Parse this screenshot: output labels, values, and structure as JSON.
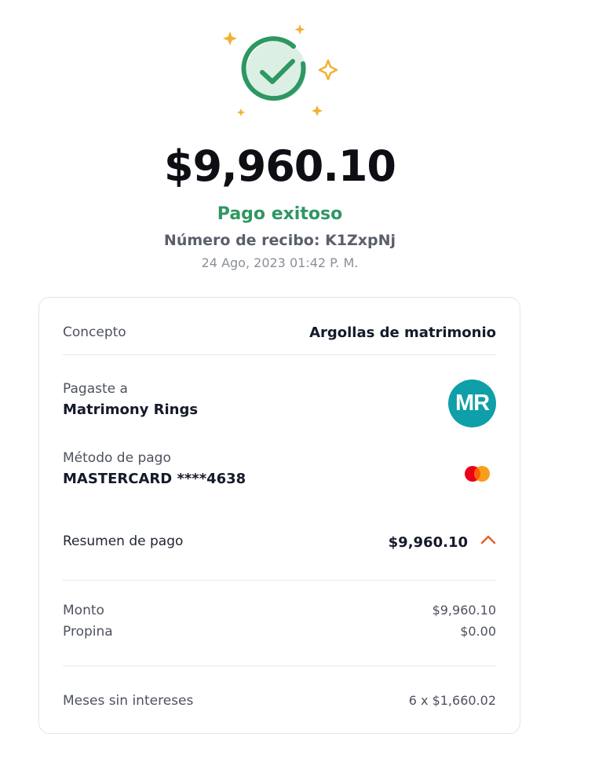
{
  "header": {
    "amount": "$9,960.10",
    "status": "Pago exitoso",
    "receipt": "Número de recibo: K1ZxpNj",
    "date": "24 Ago, 2023 01:42 P. M."
  },
  "colors": {
    "success": "#2e9762",
    "sparkle": "#f2b134",
    "avatar": "#0f9fa8",
    "accent": "#e5622a"
  },
  "details": {
    "concept_label": "Concepto",
    "concept_value": "Argollas de matrimonio",
    "paid_to_label": "Pagaste a",
    "paid_to_value": "Matrimony Rings",
    "avatar_initials": "MR",
    "method_label": "Método de pago",
    "method_value": "MASTERCARD ****4638",
    "method_icon": "mastercard-icon"
  },
  "summary": {
    "label": "Resumen de pago",
    "total": "$9,960.10",
    "expanded": true,
    "items": [
      {
        "label": "Monto",
        "value": "$9,960.10"
      },
      {
        "label": "Propina",
        "value": "$0.00"
      }
    ],
    "msi_label": "Meses sin intereses",
    "msi_value": "6 x $1,660.02"
  }
}
